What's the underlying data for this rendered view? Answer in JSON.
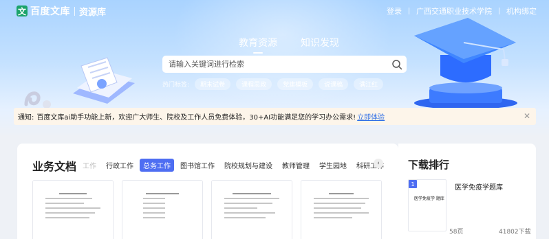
{
  "header": {
    "logo_mark": "文",
    "logo_text": "百度文库",
    "logo_sub": "资源库",
    "links": [
      "登录",
      "广西交通职业技术学院",
      "机构绑定"
    ]
  },
  "search": {
    "tabs": [
      "教育资源",
      "知识发现"
    ],
    "placeholder": "请输入关键词进行检索",
    "hot_label": "热门标签:",
    "hot_tags": [
      "期末试卷",
      "课程思政",
      "党建模板",
      "说课稿",
      "满江红"
    ]
  },
  "notice": {
    "prefix": "通知:",
    "text": "百度文库ai助手功能上新，欢迎广大师生、院校及工作人员免费体验，30+AI功能满足您的学习办公需求!",
    "link": "立即体验"
  },
  "business_docs": {
    "title": "业务文档",
    "categories": [
      "工作",
      "行政工作",
      "总务工作",
      "图书馆工作",
      "院校规划与建设",
      "教师管理",
      "学生园地",
      "科研工作"
    ],
    "active_index": 2,
    "prev_label": "‹"
  },
  "ranking": {
    "title": "下载排行",
    "items": [
      {
        "rank": "1",
        "thumb_text": "医学免疫学 题库",
        "title": "医学免疫学题库",
        "pages": "58页",
        "downloads": "41802下载"
      }
    ]
  },
  "colors": {
    "accent": "#4e6ef2",
    "logo_green": "#1aa36a",
    "notice_bg": "#fdf5ea",
    "link": "#2e6ee6"
  }
}
